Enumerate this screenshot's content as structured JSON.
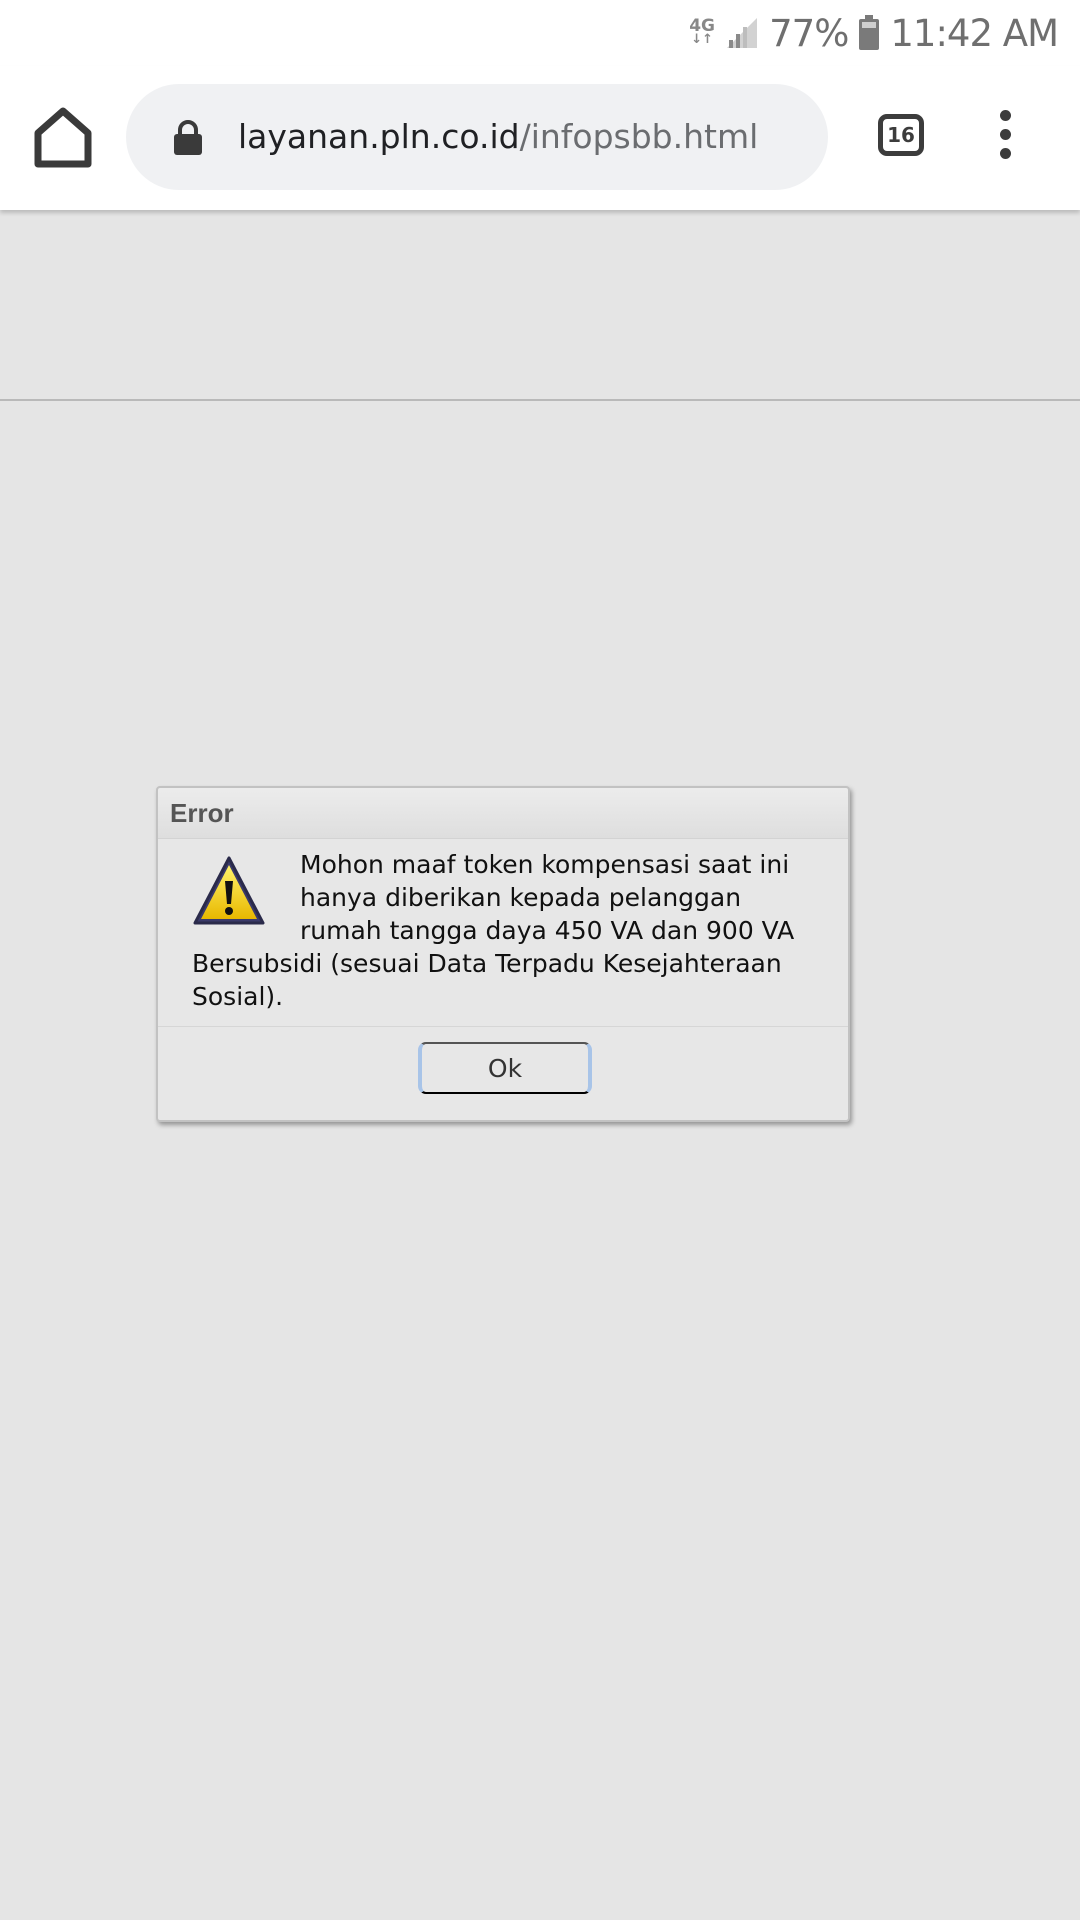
{
  "status_bar": {
    "network": "4G",
    "network_arrows": "↓↑",
    "signal_icon": "cell-signal-icon",
    "battery_percent": "77%",
    "battery_icon": "battery-icon",
    "time": "11:42 AM"
  },
  "browser": {
    "home_icon": "home-icon",
    "lock_icon": "lock-icon",
    "url_host": "layanan.pln.co.id",
    "url_path": "/infopsbb.html",
    "tab_count": "16",
    "menu_icon": "more-vert-icon"
  },
  "dialog": {
    "title": "Error",
    "icon": "warning-icon",
    "message": "Mohon maaf token kompensasi saat ini hanya diberikan kepada pelanggan rumah tangga daya 450 VA dan 900 VA Bersubsidi (sesuai Data Terpadu Kesejahteraan Sosial).",
    "ok_label": "Ok"
  },
  "colors": {
    "page_background": "#e5e5e5",
    "dialog_background": "#e7e7e7",
    "button_border": "#a8c4e8",
    "warning_yellow": "#f2d600"
  }
}
